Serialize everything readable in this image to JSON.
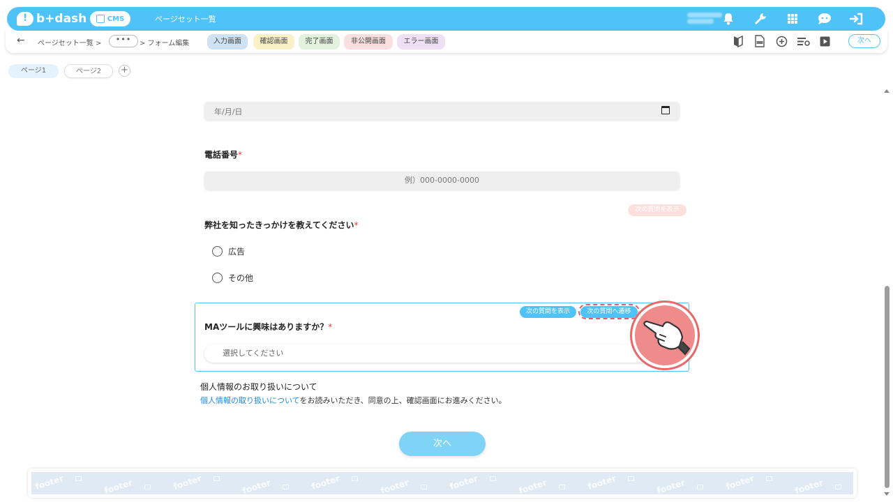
{
  "header": {
    "logo_text": "b+dash",
    "cms_label": "CMS",
    "title": "ページセット一覧",
    "icons": [
      "bell-icon",
      "wrench-icon",
      "grid-icon",
      "chat-face-icon",
      "logout-icon"
    ]
  },
  "subbar": {
    "back": "←",
    "crumb_root": "ページセット一覧 >",
    "crumb_dots": "•••",
    "crumb_current": "> フォーム編集",
    "screen_tabs": [
      {
        "label": "入力画面",
        "color": "#cfe2f3"
      },
      {
        "label": "確認画面",
        "color": "#fbf1c7"
      },
      {
        "label": "完了画面",
        "color": "#e3f2dc"
      },
      {
        "label": "非公開画面",
        "color": "#fadfe0"
      },
      {
        "label": "エラー画面",
        "color": "#efe1f5"
      }
    ],
    "tool_icons": [
      "beginner-mark-icon",
      "html-file-icon",
      "add-circle-icon",
      "settings-list-icon",
      "play-icon"
    ],
    "next_label": "次へ"
  },
  "pages": {
    "tabs": [
      "ページ1",
      "ページ2"
    ],
    "add": "+"
  },
  "form": {
    "date_placeholder": "年/月/日",
    "phone_label": "電話番号",
    "phone_placeholder": "例）000-0000-0000",
    "required_mark": "*",
    "ghost_badge": "次の質問を表示",
    "question_label": "弊社を知ったきっかけを教えてください",
    "options": [
      "広告",
      "その他"
    ],
    "ma_label": "MAツールに興味はありますか？",
    "badge_show": "次の質問を表示",
    "badge_jump": "次の質問へ遷移",
    "select_placeholder": "選択してください",
    "privacy_title": "個人情報のお取り扱いについて",
    "privacy_link": "個人情報の取り扱いについて",
    "privacy_rest": "をお読みいただき、同意の上、確認画面にお進みください。",
    "next_button": "次へ"
  },
  "footer": {
    "word": "footer"
  }
}
